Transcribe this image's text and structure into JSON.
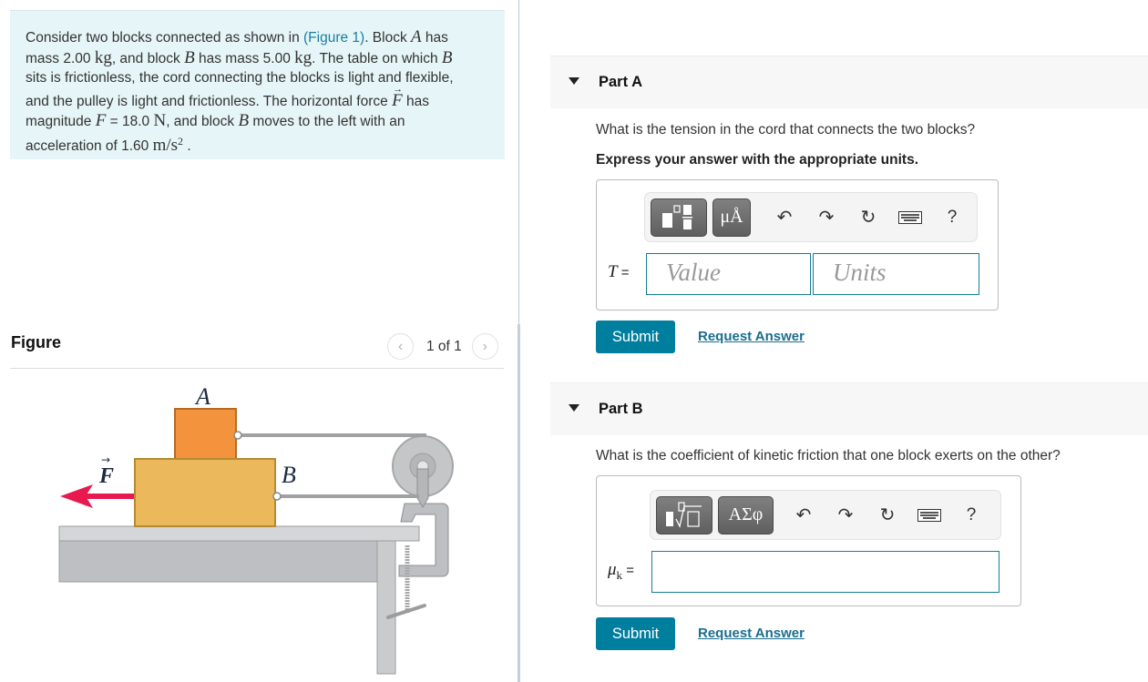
{
  "problem": {
    "intro": "Consider two blocks connected as shown in ",
    "figure_link": "(Figure 1)",
    "line1_rest": ". Block ",
    "var_A": "A",
    "has": " has",
    "mass_word": "mass 2.00 ",
    "kg": "kg",
    "and_block": ", and block ",
    "var_B": "B",
    "has_mass_5": " has mass 5.00 ",
    "table_on_which": ". The table on which ",
    "line3": "sits is frictionless, the cord connecting the blocks is light and flexible,",
    "line4": "and the pulley is light and frictionless. The horizontal force ",
    "var_F": "F",
    "line5a": "magnitude ",
    "force_value": " = 18.0 ",
    "N": "N",
    "line5b": ", and block ",
    "line5c": " moves to the left with an",
    "line6": "acceleration of 1.60 ",
    "accel_units": "m/s",
    "sup2": "2",
    "period": " ."
  },
  "figure": {
    "title": "Figure",
    "pager_text": "1 of 1",
    "prev_icon": "chevron-left-icon",
    "next_icon": "chevron-right-icon",
    "label_A": "A",
    "label_B": "B",
    "label_F": "F",
    "colors": {
      "block_A": "#f4933d",
      "block_B": "#ebb85c",
      "force_arrow": "#e8194f",
      "metal": "#c4c6c8"
    }
  },
  "partA": {
    "title": "Part A",
    "question": "What is the tension in the cord that connects the two blocks?",
    "instruction": "Express your answer with the appropriate units.",
    "toolbar": {
      "template_icon": "templates-icon",
      "units_label": "μÅ",
      "undo_icon": "undo-icon",
      "redo_icon": "redo-icon",
      "reset_icon": "reset-icon",
      "keyboard_icon": "keyboard-icon",
      "help_label": "?"
    },
    "var_label": "T",
    "eq": " =",
    "value_placeholder": "Value",
    "units_placeholder": "Units",
    "value": "",
    "units": "",
    "submit_label": "Submit",
    "request_label": "Request Answer"
  },
  "partB": {
    "title": "Part B",
    "question": "What is the coefficient of kinetic friction that one block exerts on the other?",
    "toolbar": {
      "template_icon": "radical-template-icon",
      "greek_label": "ΑΣφ",
      "undo_icon": "undo-icon",
      "redo_icon": "redo-icon",
      "reset_icon": "reset-icon",
      "keyboard_icon": "keyboard-icon",
      "help_label": "?"
    },
    "var_label": "μ",
    "var_sub": "k",
    "eq": " =",
    "value": "",
    "submit_label": "Submit",
    "request_label": "Request Answer"
  },
  "colors": {
    "accent": "#007e9e",
    "problem_bg": "#e6f5f7",
    "link": "#1a7ea0",
    "field_border": "#147d95"
  }
}
